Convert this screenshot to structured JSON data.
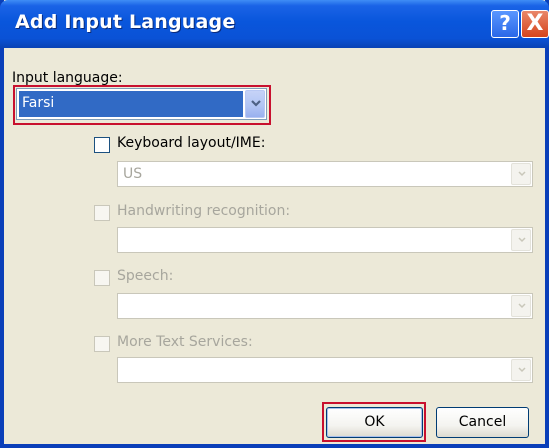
{
  "dialog": {
    "title": "Add Input Language",
    "help_button": "?",
    "close_button": "X"
  },
  "input_language": {
    "label": "Input language:",
    "selected": "Farsi"
  },
  "options": {
    "keyboard": {
      "label": "Keyboard layout/IME:",
      "value": "US",
      "checked": false,
      "enabled": true
    },
    "handwriting": {
      "label": "Handwriting recognition:",
      "value": "",
      "checked": false,
      "enabled": false
    },
    "speech": {
      "label": "Speech:",
      "value": "",
      "checked": false,
      "enabled": false
    },
    "text_services": {
      "label": "More Text Services:",
      "value": "",
      "checked": false,
      "enabled": false
    }
  },
  "buttons": {
    "ok": "OK",
    "cancel": "Cancel"
  },
  "colors": {
    "title_bar": "#0a52d6",
    "highlight": "#c8102e",
    "selection": "#316ac5",
    "disabled_text": "#a7a69d"
  }
}
